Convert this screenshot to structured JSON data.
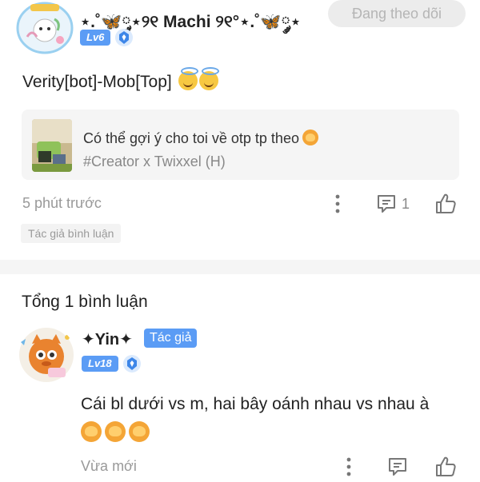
{
  "post": {
    "username": "⋆.˚🦋༘⋆୨୧ Machi ୨୧°⋆.˚🦋༘⋆",
    "level": "Lv6",
    "follow_label": "Đang theo dõi",
    "text": "Verity[bot]-Mob[Top]",
    "quote": {
      "title": "Có thể gợi ý cho toi về otp tp theo",
      "subtitle": "#Creator x Twixxel (H)"
    },
    "timestamp": "5 phút trước",
    "reply_count": "1",
    "author_tag": "Tác giả bình luận"
  },
  "replies": {
    "total": "Tổng 1 bình luận",
    "items": [
      {
        "username": "✦Yin✦",
        "author_badge": "Tác giả",
        "level": "Lv18",
        "text": "Cái bl dưới vs m, hai bây oánh nhau vs nhau à",
        "timestamp": "Vừa mới"
      }
    ]
  },
  "icons": {
    "more": "more-vertical-icon",
    "reply": "reply-comment-icon",
    "like": "thumbs-up-icon",
    "medal": "medal-icon",
    "halo_emoji": "smiling-face-with-halo-emoji",
    "shrug_emoji": "person-gesturing-emoji"
  },
  "colors": {
    "accent": "#5b9cf5",
    "muted_text": "#999999",
    "card_bg": "#f5f5f5"
  }
}
